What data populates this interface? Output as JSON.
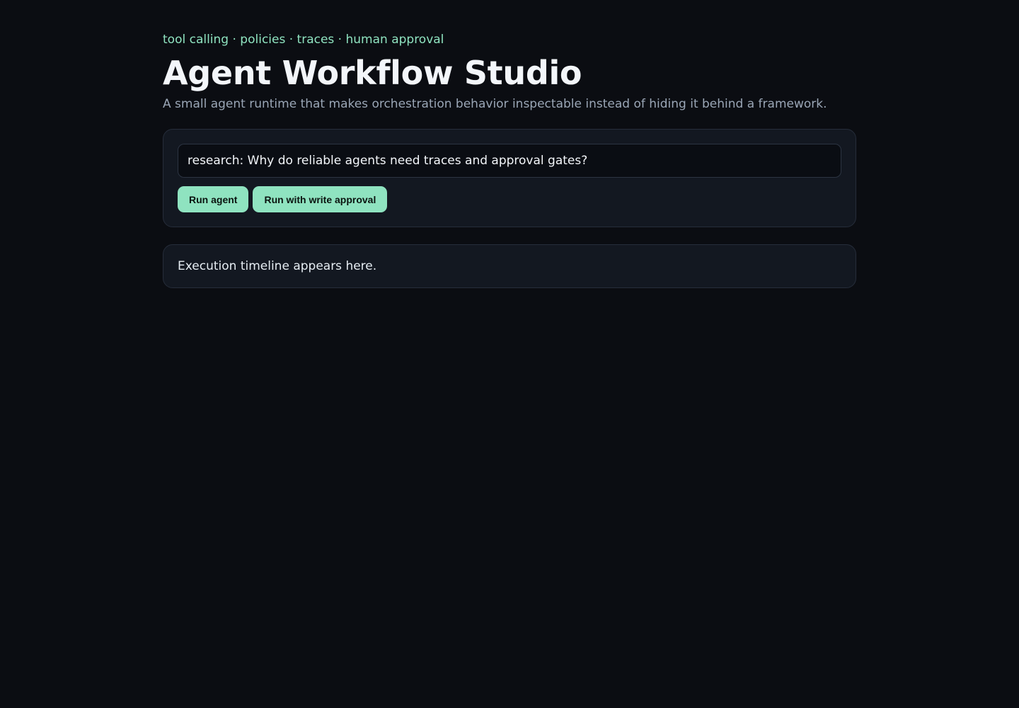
{
  "header": {
    "eyebrow": "tool calling · policies · traces · human approval",
    "title": "Agent Workflow Studio",
    "subtitle": "A small agent runtime that makes orchestration behavior inspectable instead of hiding it behind a framework."
  },
  "composer": {
    "prompt_value": "research: Why do reliable agents need traces and approval gates?",
    "run_label": "Run agent",
    "run_approval_label": "Run with write approval"
  },
  "timeline": {
    "placeholder": "Execution timeline appears here."
  },
  "colors": {
    "background": "#0b0d12",
    "card": "#131821",
    "accent": "#8fe3c0"
  }
}
